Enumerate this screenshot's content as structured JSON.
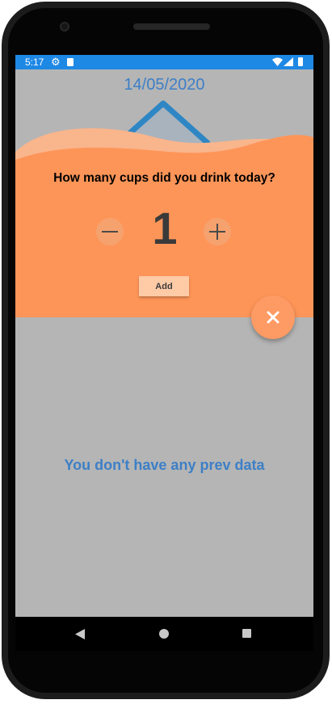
{
  "status_bar": {
    "time": "5:17",
    "gear_icon": "gear-icon",
    "sd_icon": "sd-card-icon",
    "wifi_icon": "wifi-icon",
    "signal_icon": "signal-icon",
    "battery_icon": "battery-icon",
    "color": "#1e88e5"
  },
  "header": {
    "date": "14/05/2020"
  },
  "dialog": {
    "question": "How many cups did you drink today?",
    "count": "1",
    "decrement_icon": "minus-icon",
    "increment_icon": "plus-icon",
    "add_label": "Add",
    "close_icon": "close-icon",
    "accent": "#fe9a63"
  },
  "main": {
    "empty_message": "You don't have any prev data"
  },
  "nav_bar": {
    "back_icon": "back-triangle-icon",
    "home_icon": "home-circle-icon",
    "recents_icon": "recents-square-icon"
  }
}
